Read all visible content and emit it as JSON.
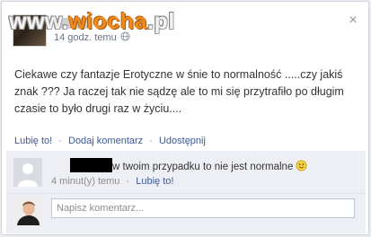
{
  "watermark": {
    "prefix": "www.",
    "accent": "wiocha",
    "suffix": ".pl"
  },
  "post": {
    "timestamp": "14 godz. temu",
    "text": "Ciekawe czy fantazje Erotyczne w śnie to normalność .....czy jakiś znak ??? Ja raczej tak nie sądzę ale to mi się przytrafiło po długim czasie to było drugi raz w życiu....",
    "close_label": "×"
  },
  "actions": {
    "like": "Lubię to!",
    "comment": "Dodaj komentarz",
    "share": "Udostępnij",
    "separator": "·"
  },
  "comment": {
    "text": "w twoim przypadku to nie jest normalne",
    "time": "4 minut(y) temu",
    "like": "Lubię to!",
    "separator": "·"
  },
  "composer": {
    "placeholder": "Napisz komentarz..."
  }
}
